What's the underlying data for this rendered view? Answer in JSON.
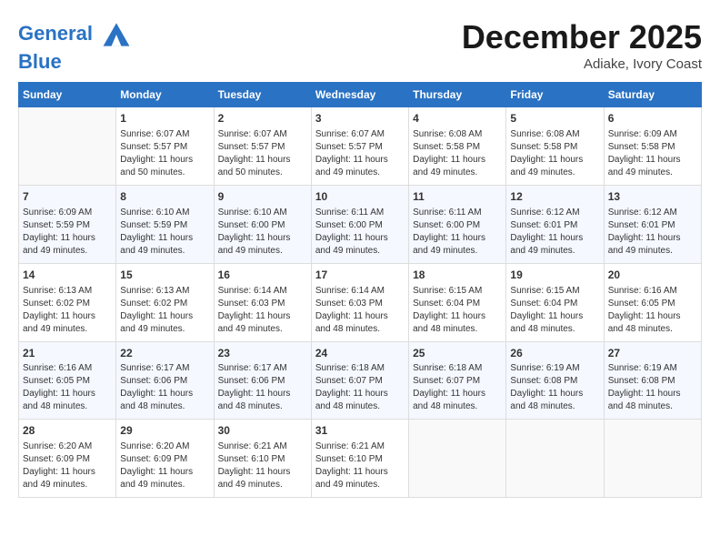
{
  "header": {
    "logo_line1": "General",
    "logo_line2": "Blue",
    "month_title": "December 2025",
    "location": "Adiake, Ivory Coast"
  },
  "weekdays": [
    "Sunday",
    "Monday",
    "Tuesday",
    "Wednesday",
    "Thursday",
    "Friday",
    "Saturday"
  ],
  "weeks": [
    [
      {
        "day": "",
        "sunrise": "",
        "sunset": "",
        "daylight": "",
        "empty": true
      },
      {
        "day": "1",
        "sunrise": "6:07 AM",
        "sunset": "5:57 PM",
        "daylight": "11 hours and 50 minutes."
      },
      {
        "day": "2",
        "sunrise": "6:07 AM",
        "sunset": "5:57 PM",
        "daylight": "11 hours and 50 minutes."
      },
      {
        "day": "3",
        "sunrise": "6:07 AM",
        "sunset": "5:57 PM",
        "daylight": "11 hours and 49 minutes."
      },
      {
        "day": "4",
        "sunrise": "6:08 AM",
        "sunset": "5:58 PM",
        "daylight": "11 hours and 49 minutes."
      },
      {
        "day": "5",
        "sunrise": "6:08 AM",
        "sunset": "5:58 PM",
        "daylight": "11 hours and 49 minutes."
      },
      {
        "day": "6",
        "sunrise": "6:09 AM",
        "sunset": "5:58 PM",
        "daylight": "11 hours and 49 minutes."
      }
    ],
    [
      {
        "day": "7",
        "sunrise": "6:09 AM",
        "sunset": "5:59 PM",
        "daylight": "11 hours and 49 minutes."
      },
      {
        "day": "8",
        "sunrise": "6:10 AM",
        "sunset": "5:59 PM",
        "daylight": "11 hours and 49 minutes."
      },
      {
        "day": "9",
        "sunrise": "6:10 AM",
        "sunset": "6:00 PM",
        "daylight": "11 hours and 49 minutes."
      },
      {
        "day": "10",
        "sunrise": "6:11 AM",
        "sunset": "6:00 PM",
        "daylight": "11 hours and 49 minutes."
      },
      {
        "day": "11",
        "sunrise": "6:11 AM",
        "sunset": "6:00 PM",
        "daylight": "11 hours and 49 minutes."
      },
      {
        "day": "12",
        "sunrise": "6:12 AM",
        "sunset": "6:01 PM",
        "daylight": "11 hours and 49 minutes."
      },
      {
        "day": "13",
        "sunrise": "6:12 AM",
        "sunset": "6:01 PM",
        "daylight": "11 hours and 49 minutes."
      }
    ],
    [
      {
        "day": "14",
        "sunrise": "6:13 AM",
        "sunset": "6:02 PM",
        "daylight": "11 hours and 49 minutes."
      },
      {
        "day": "15",
        "sunrise": "6:13 AM",
        "sunset": "6:02 PM",
        "daylight": "11 hours and 49 minutes."
      },
      {
        "day": "16",
        "sunrise": "6:14 AM",
        "sunset": "6:03 PM",
        "daylight": "11 hours and 49 minutes."
      },
      {
        "day": "17",
        "sunrise": "6:14 AM",
        "sunset": "6:03 PM",
        "daylight": "11 hours and 48 minutes."
      },
      {
        "day": "18",
        "sunrise": "6:15 AM",
        "sunset": "6:04 PM",
        "daylight": "11 hours and 48 minutes."
      },
      {
        "day": "19",
        "sunrise": "6:15 AM",
        "sunset": "6:04 PM",
        "daylight": "11 hours and 48 minutes."
      },
      {
        "day": "20",
        "sunrise": "6:16 AM",
        "sunset": "6:05 PM",
        "daylight": "11 hours and 48 minutes."
      }
    ],
    [
      {
        "day": "21",
        "sunrise": "6:16 AM",
        "sunset": "6:05 PM",
        "daylight": "11 hours and 48 minutes."
      },
      {
        "day": "22",
        "sunrise": "6:17 AM",
        "sunset": "6:06 PM",
        "daylight": "11 hours and 48 minutes."
      },
      {
        "day": "23",
        "sunrise": "6:17 AM",
        "sunset": "6:06 PM",
        "daylight": "11 hours and 48 minutes."
      },
      {
        "day": "24",
        "sunrise": "6:18 AM",
        "sunset": "6:07 PM",
        "daylight": "11 hours and 48 minutes."
      },
      {
        "day": "25",
        "sunrise": "6:18 AM",
        "sunset": "6:07 PM",
        "daylight": "11 hours and 48 minutes."
      },
      {
        "day": "26",
        "sunrise": "6:19 AM",
        "sunset": "6:08 PM",
        "daylight": "11 hours and 48 minutes."
      },
      {
        "day": "27",
        "sunrise": "6:19 AM",
        "sunset": "6:08 PM",
        "daylight": "11 hours and 48 minutes."
      }
    ],
    [
      {
        "day": "28",
        "sunrise": "6:20 AM",
        "sunset": "6:09 PM",
        "daylight": "11 hours and 49 minutes."
      },
      {
        "day": "29",
        "sunrise": "6:20 AM",
        "sunset": "6:09 PM",
        "daylight": "11 hours and 49 minutes."
      },
      {
        "day": "30",
        "sunrise": "6:21 AM",
        "sunset": "6:10 PM",
        "daylight": "11 hours and 49 minutes."
      },
      {
        "day": "31",
        "sunrise": "6:21 AM",
        "sunset": "6:10 PM",
        "daylight": "11 hours and 49 minutes."
      },
      {
        "day": "",
        "sunrise": "",
        "sunset": "",
        "daylight": "",
        "empty": true
      },
      {
        "day": "",
        "sunrise": "",
        "sunset": "",
        "daylight": "",
        "empty": true
      },
      {
        "day": "",
        "sunrise": "",
        "sunset": "",
        "daylight": "",
        "empty": true
      }
    ]
  ],
  "labels": {
    "sunrise_prefix": "Sunrise: ",
    "sunset_prefix": "Sunset: ",
    "daylight_prefix": "Daylight: "
  }
}
